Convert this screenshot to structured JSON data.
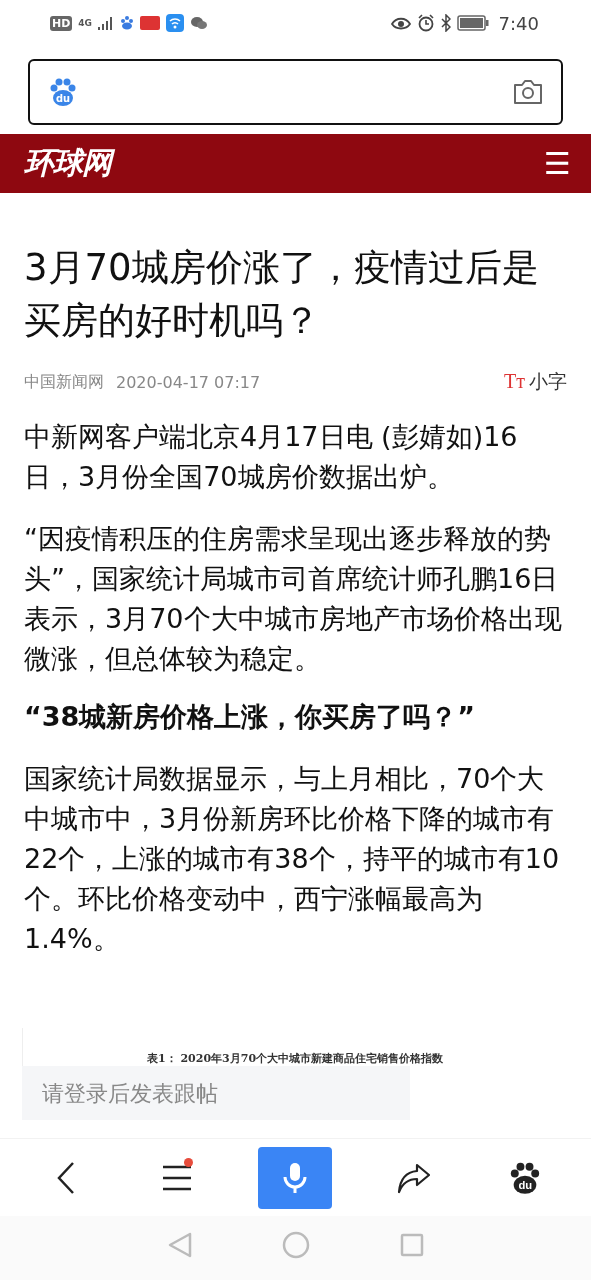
{
  "status_bar": {
    "left": [
      "HD",
      "4G"
    ],
    "time": "7:40"
  },
  "search_bar": {
    "logo": "du"
  },
  "site_header": {
    "logo": "环球网",
    "menu": "☰"
  },
  "article": {
    "title": "3月70城房价涨了，疫情过后是买房的好时机吗？",
    "source": "中国新闻网",
    "date": "2020-04-17 07:17",
    "font_toggle": {
      "icon": "Tт",
      "label": "小字"
    },
    "paragraphs": [
      {
        "kind": "text",
        "text": "中新网客户端北京4月17日电 (彭婧如)16日，3月份全国70城房价数据出炉。"
      },
      {
        "kind": "text",
        "text": "“因疫情积压的住房需求呈现出逐步释放的势头”，国家统计局城市司首席统计师孔鹏16日表示，3月70个大中城市房地产市场价格出现微涨，但总体较为稳定。"
      },
      {
        "kind": "heading",
        "text": "“38城新房价格上涨，你买房了吗？”"
      },
      {
        "kind": "text",
        "text": "国家统计局数据显示，与上月相比，70个大中城市中，3月份新房环比价格下降的城市有22个，上涨的城市有38个，持平的城市有10个。环比价格变动中，西宁涨幅最高为1.4%。"
      }
    ],
    "figure_caption": "表1： 2020年3月70个大中城市新建商品住宅销售价格指数"
  },
  "comment": {
    "placeholder": "请登录后发表跟帖"
  },
  "bottom_nav": [
    {
      "kind": "back",
      "badge": false
    },
    {
      "kind": "menu",
      "badge": true
    },
    {
      "kind": "voice",
      "badge": false
    },
    {
      "kind": "share",
      "badge": false
    },
    {
      "kind": "paw",
      "badge": false,
      "label": "du"
    }
  ]
}
